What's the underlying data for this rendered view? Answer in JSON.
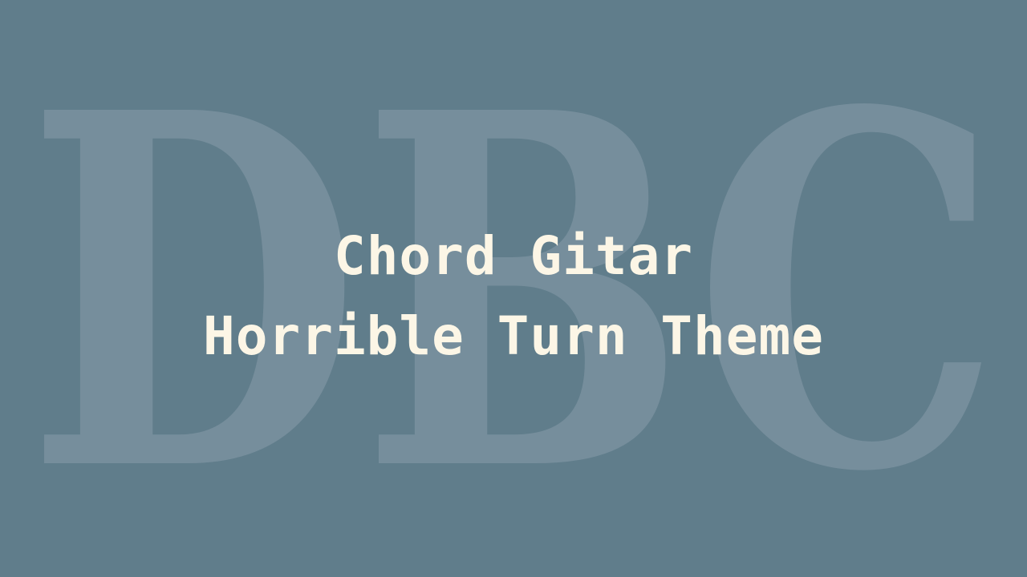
{
  "watermark": {
    "text": "DBC"
  },
  "title": {
    "line1": "Chord Gitar",
    "line2": "Horrible Turn Theme"
  },
  "colors": {
    "background": "#607d8b",
    "watermark": "#768e9c",
    "title_text": "#fcf6e6"
  }
}
